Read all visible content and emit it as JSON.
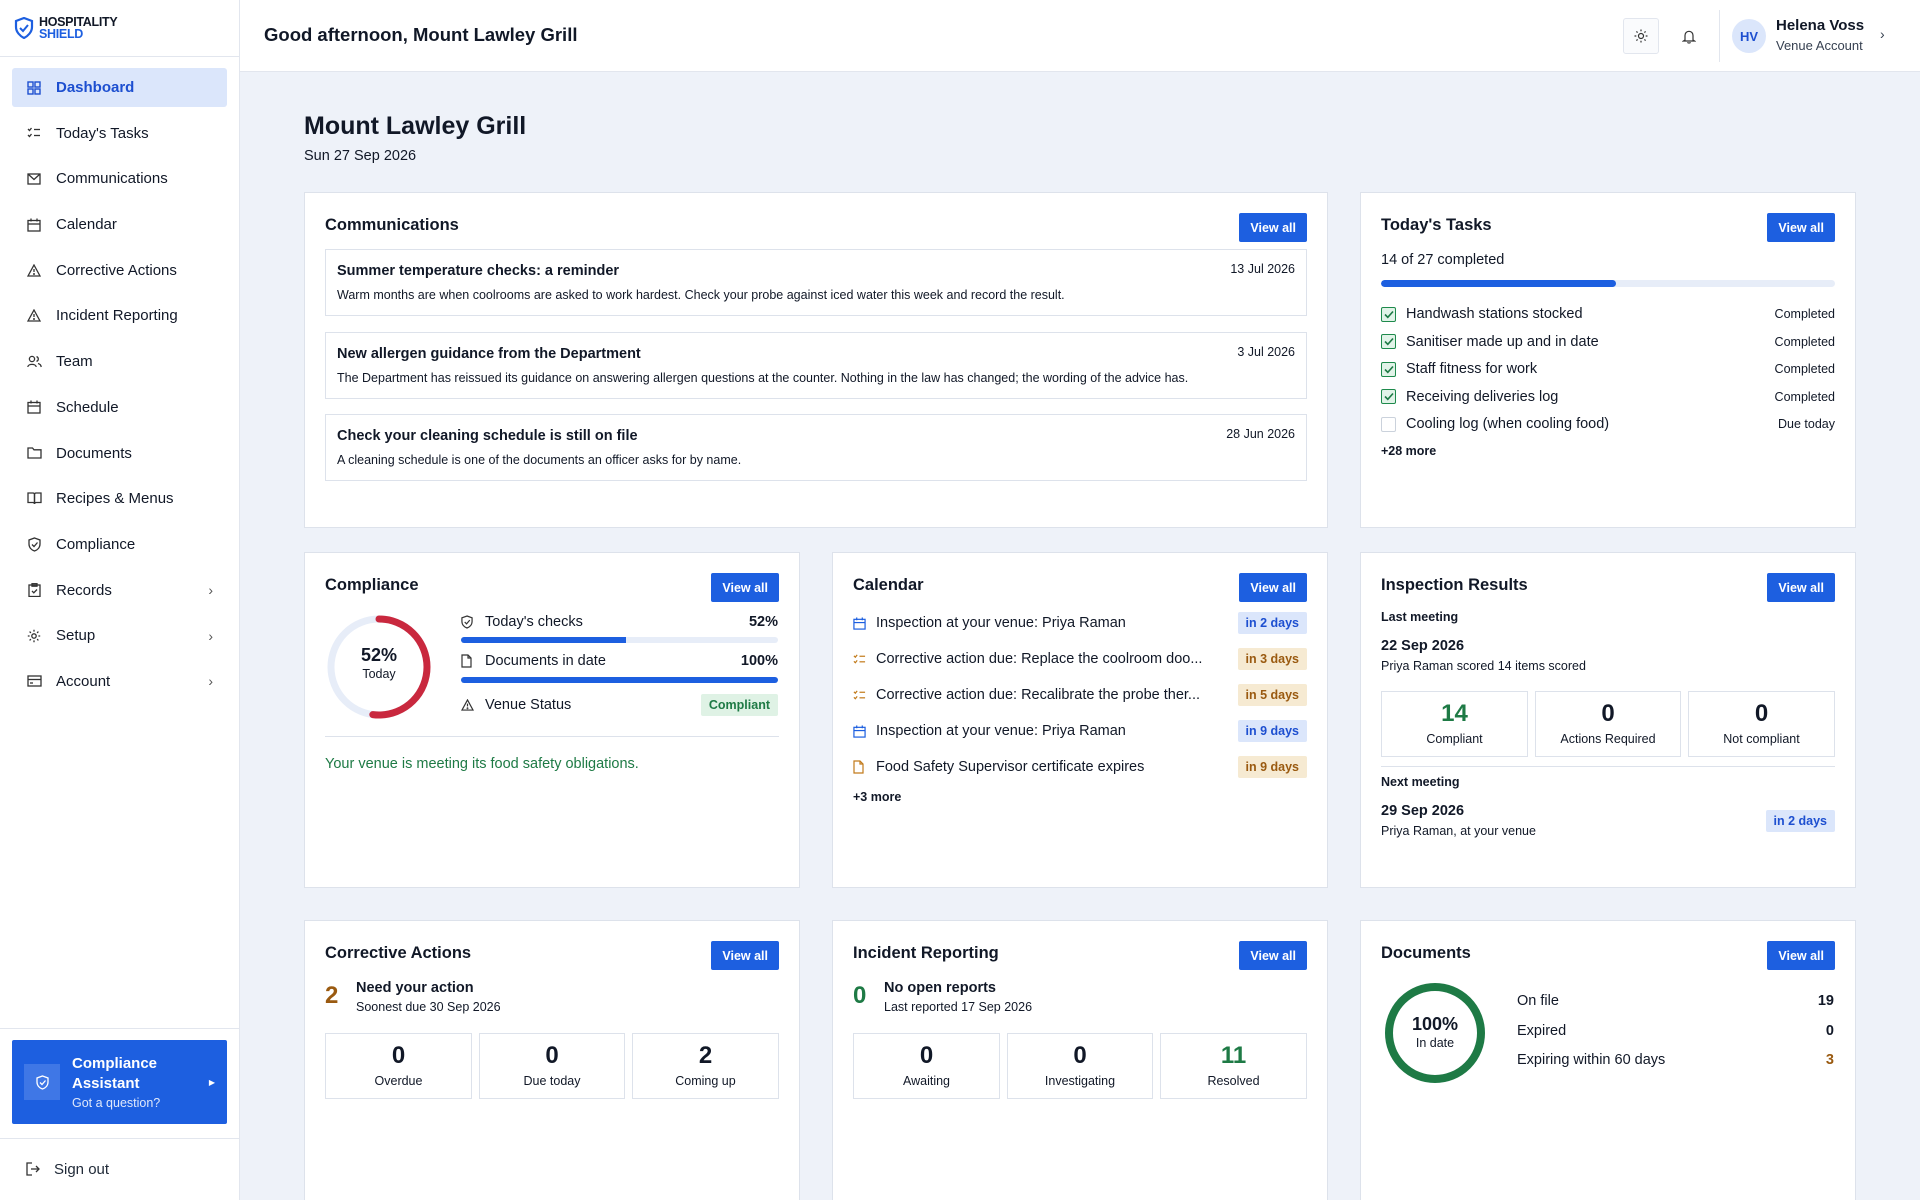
{
  "brand": {
    "line1": "HOSPITALITY",
    "line2": "SHIELD"
  },
  "sidebar": {
    "items": [
      {
        "label": "Dashboard"
      },
      {
        "label": "Today's Tasks"
      },
      {
        "label": "Communications"
      },
      {
        "label": "Calendar"
      },
      {
        "label": "Corrective Actions"
      },
      {
        "label": "Incident Reporting"
      },
      {
        "label": "Team"
      },
      {
        "label": "Schedule"
      },
      {
        "label": "Documents"
      },
      {
        "label": "Recipes & Menus"
      },
      {
        "label": "Compliance"
      },
      {
        "label": "Records"
      },
      {
        "label": "Setup"
      },
      {
        "label": "Account"
      }
    ],
    "assistant": {
      "title": "Compliance Assistant",
      "subtitle": "Got a question?"
    },
    "signout": "Sign out"
  },
  "header": {
    "greeting": "Good afternoon, Mount Lawley Grill",
    "user": {
      "initials": "HV",
      "name": "Helena Voss",
      "role": "Venue Account"
    }
  },
  "venue": {
    "name": "Mount Lawley Grill",
    "date": "Sun 27 Sep 2026"
  },
  "view_all": "View all",
  "communications": {
    "title": "Communications",
    "items": [
      {
        "title": "Summer temperature checks: a reminder",
        "date": "13 Jul 2026",
        "body": "Warm months are when coolrooms are asked to work hardest. Check your probe against iced water this week and record the result."
      },
      {
        "title": "New allergen guidance from the Department",
        "date": "3 Jul 2026",
        "body": "The Department has reissued its guidance on answering allergen questions at the counter. Nothing in the law has changed; the wording of the advice has."
      },
      {
        "title": "Check your cleaning schedule is still on file",
        "date": "28 Jun 2026",
        "body": "A cleaning schedule is one of the documents an officer asks for by name."
      }
    ]
  },
  "tasks": {
    "title": "Today's Tasks",
    "progress_text": "14 of 27 completed",
    "completed": 14,
    "total": 27,
    "items": [
      {
        "label": "Handwash stations stocked",
        "status": "Completed",
        "done": true
      },
      {
        "label": "Sanitiser made up and in date",
        "status": "Completed",
        "done": true
      },
      {
        "label": "Staff fitness for work",
        "status": "Completed",
        "done": true
      },
      {
        "label": "Receiving deliveries log",
        "status": "Completed",
        "done": true
      },
      {
        "label": "Cooling log (when cooling food)",
        "status": "Due today",
        "done": false
      }
    ],
    "more": "+28 more"
  },
  "compliance": {
    "title": "Compliance",
    "ring_value": "52%",
    "ring_label": "Today",
    "ring_fraction": 0.52,
    "checks_label": "Today's checks",
    "checks_value": "52%",
    "checks_fraction": 0.52,
    "docs_label": "Documents in date",
    "docs_value": "100%",
    "docs_fraction": 1.0,
    "status_label": "Venue Status",
    "status_value": "Compliant",
    "message": "Your venue is meeting its food safety obligations."
  },
  "calendar": {
    "title": "Calendar",
    "items": [
      {
        "icon": "calendar-icon",
        "label": "Inspection at your venue: Priya Raman",
        "when": "in 2 days",
        "tone": "blue"
      },
      {
        "icon": "task-list-icon",
        "label": "Corrective action due: Replace the coolroom doo...",
        "when": "in 3 days",
        "tone": "amber"
      },
      {
        "icon": "task-list-icon",
        "label": "Corrective action due: Recalibrate the probe ther...",
        "when": "in 5 days",
        "tone": "amber"
      },
      {
        "icon": "calendar-icon",
        "label": "Inspection at your venue: Priya Raman",
        "when": "in 9 days",
        "tone": "blue"
      },
      {
        "icon": "document-icon",
        "label": "Food Safety Supervisor certificate expires",
        "when": "in 9 days",
        "tone": "amber"
      }
    ],
    "more": "+3 more"
  },
  "inspections": {
    "title": "Inspection Results",
    "last_label": "Last meeting",
    "last_date": "22 Sep 2026",
    "last_desc": "Priya Raman scored 14 items scored",
    "stats": [
      {
        "value": "14",
        "label": "Compliant"
      },
      {
        "value": "0",
        "label": "Actions Required"
      },
      {
        "value": "0",
        "label": "Not compliant"
      }
    ],
    "next_label": "Next meeting",
    "next_date": "29 Sep 2026",
    "next_desc": "Priya Raman, at your venue",
    "next_when": "in 2 days"
  },
  "corrective": {
    "title": "Corrective Actions",
    "count": "2",
    "headline": "Need your action",
    "sub": "Soonest due 30 Sep 2026",
    "stats": [
      {
        "value": "0",
        "label": "Overdue"
      },
      {
        "value": "0",
        "label": "Due today"
      },
      {
        "value": "2",
        "label": "Coming up"
      }
    ]
  },
  "incidents": {
    "title": "Incident Reporting",
    "count": "0",
    "headline": "No open reports",
    "sub": "Last reported 17 Sep 2026",
    "stats": [
      {
        "value": "0",
        "label": "Awaiting"
      },
      {
        "value": "0",
        "label": "Investigating"
      },
      {
        "value": "11",
        "label": "Resolved"
      }
    ]
  },
  "documents": {
    "title": "Documents",
    "ring_value": "100%",
    "ring_label": "In date",
    "ring_fraction": 1.0,
    "rows": [
      {
        "label": "On file",
        "value": "19"
      },
      {
        "label": "Expired",
        "value": "0"
      },
      {
        "label": "Expiring within 60 days",
        "value": "3"
      }
    ]
  },
  "colors": {
    "accent": "#1d5fe0",
    "success": "#1e7a45",
    "warning": "#9a5a10",
    "danger": "#c9283e"
  }
}
